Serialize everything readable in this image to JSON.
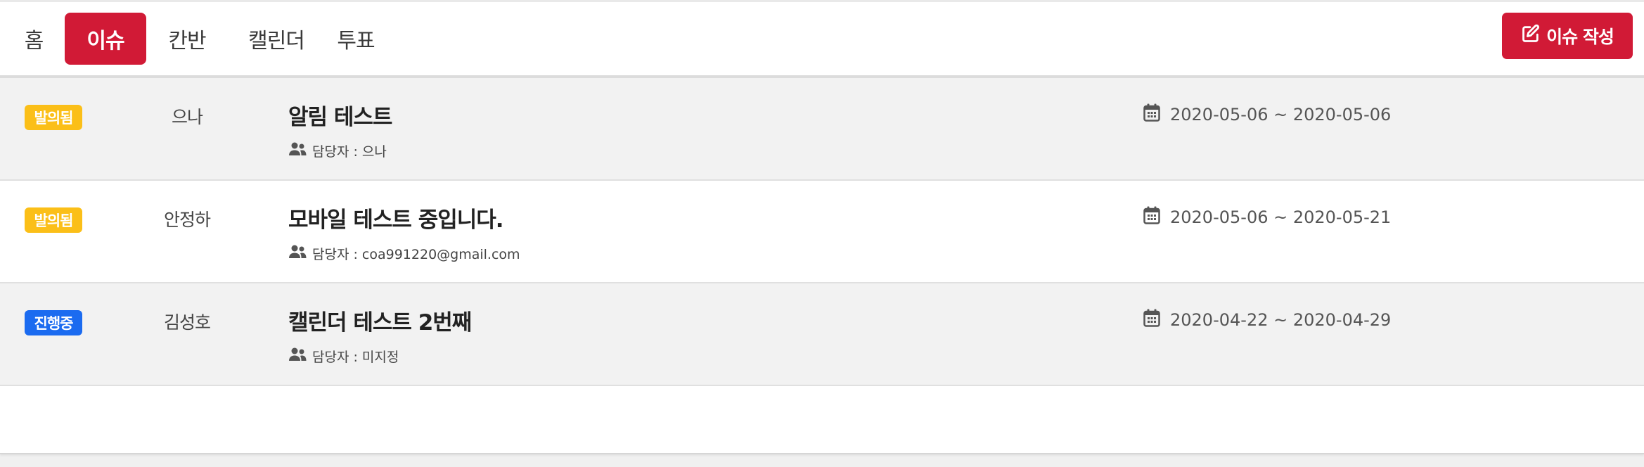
{
  "nav": {
    "tabs": [
      {
        "label": "홈"
      },
      {
        "label": "이슈"
      },
      {
        "label": "칸반"
      },
      {
        "label": "캘린더"
      },
      {
        "label": "투표"
      }
    ],
    "active_tab": "이슈",
    "write_button_label": "이슈 작성"
  },
  "issues": [
    {
      "status": "발의됨",
      "author": "으나",
      "title": "알림 테스트",
      "assignee": "담당자 : 으나",
      "date_range": "2020-05-06 ~ 2020-05-06"
    },
    {
      "status": "발의됨",
      "author": "안정하",
      "title": "모바일 테스트 중입니다.",
      "assignee": "담당자 : coa991220@gmail.com",
      "date_range": "2020-05-06 ~ 2020-05-21"
    },
    {
      "status": "진행중",
      "author": "김성호",
      "title": "캘린더 테스트 2번째",
      "assignee": "담당자 : 미지정",
      "date_range": "2020-04-22 ~ 2020-04-29"
    }
  ],
  "colors": {
    "accent": "#d11a36",
    "status_proposed": "#fbbf18",
    "status_in_progress": "#1b6bf0"
  }
}
